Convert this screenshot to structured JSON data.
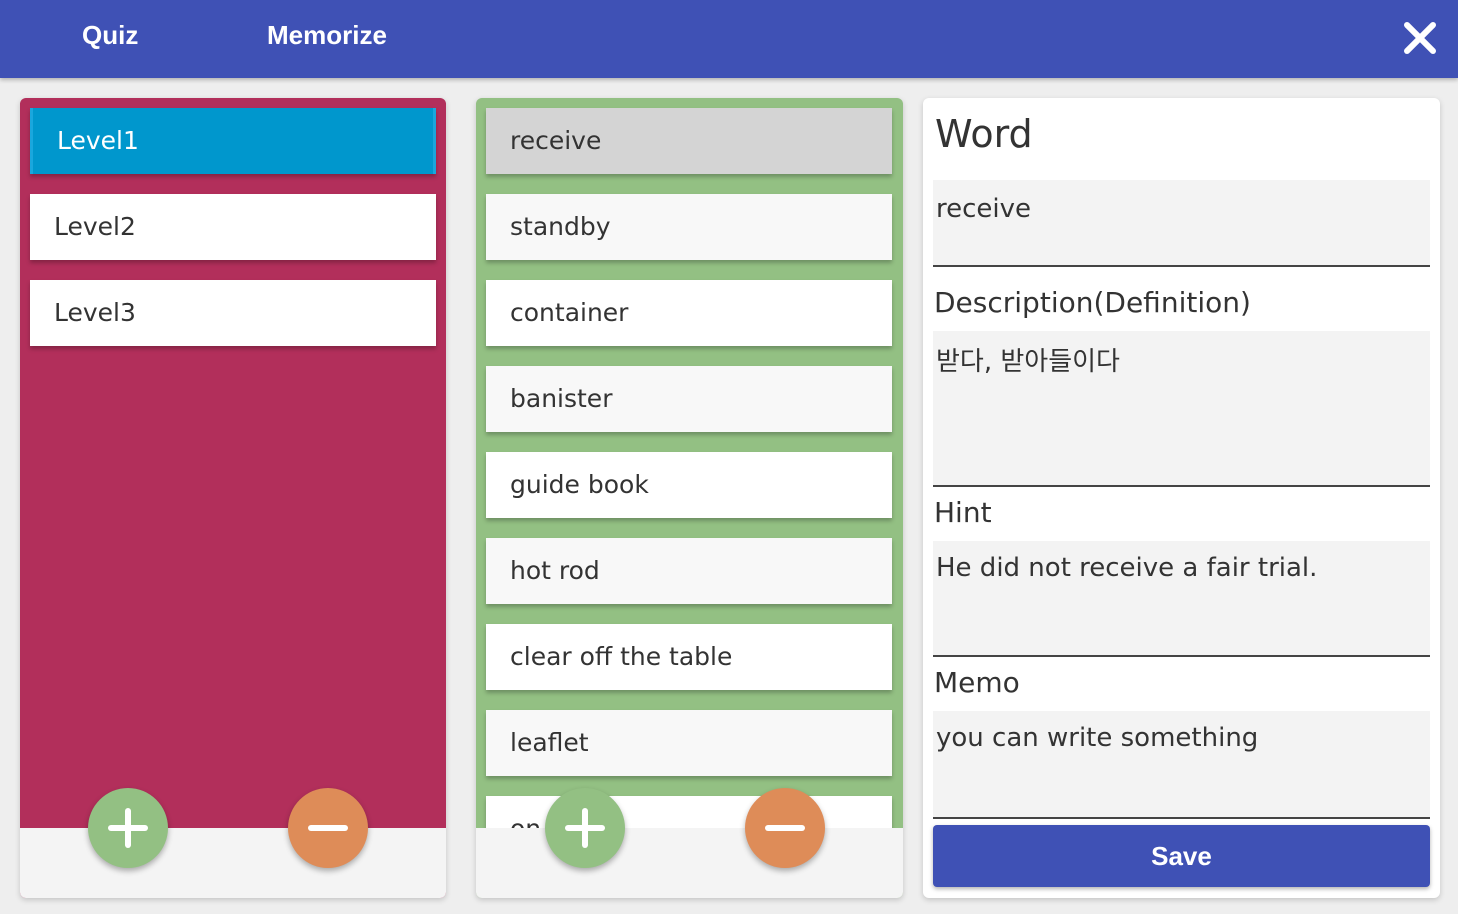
{
  "header": {
    "tabs": [
      {
        "label": "Quiz"
      },
      {
        "label": "Memorize"
      }
    ],
    "close_icon": "close-icon"
  },
  "levels": {
    "items": [
      {
        "label": "Level1",
        "selected": true
      },
      {
        "label": "Level2",
        "selected": false
      },
      {
        "label": "Level3",
        "selected": false
      }
    ],
    "add_icon": "plus-icon",
    "remove_icon": "minus-icon"
  },
  "words": {
    "items": [
      {
        "label": "receive",
        "selected": true
      },
      {
        "label": "standby",
        "selected": false
      },
      {
        "label": "container",
        "selected": false
      },
      {
        "label": "banister",
        "selected": false
      },
      {
        "label": "guide book",
        "selected": false
      },
      {
        "label": "hot rod",
        "selected": false
      },
      {
        "label": "clear off the table",
        "selected": false
      },
      {
        "label": "leaflet",
        "selected": false
      },
      {
        "label": "on t...r",
        "selected": false
      }
    ],
    "add_icon": "plus-icon",
    "remove_icon": "minus-icon"
  },
  "detail": {
    "title": "Word",
    "word_value": "receive",
    "description_label": "Description(Definition)",
    "description_value": "받다, 받아들이다",
    "hint_label": "Hint",
    "hint_value": "He did not receive a fair trial.",
    "memo_label": "Memo",
    "memo_value": "you can write something",
    "save_label": "Save"
  },
  "colors": {
    "header": "#3f51b5",
    "levels_panel": "#b22f5b",
    "words_panel": "#93c083",
    "selected_level": "#0097cd",
    "fab_add": "#93c083",
    "fab_remove": "#de8c58",
    "save_button": "#3f51b5"
  }
}
